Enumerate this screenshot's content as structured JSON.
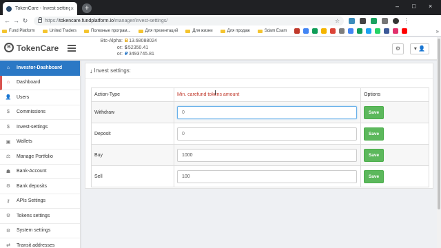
{
  "browser": {
    "tab_title": "TokenCare - Invest settings",
    "tab_close": "×",
    "new_tab": "+",
    "url_host": "tokencare.fundplatform.io",
    "url_path": "/manager/invest-settings/",
    "url_scheme": "https://",
    "window_controls": [
      "–",
      "□",
      "×"
    ],
    "bookmarks": [
      "Fund Platform",
      "United Traders",
      "Полезные програм...",
      "Для презентаций",
      "Для жизни",
      "Для продаж",
      "Sdam Exam"
    ],
    "bookmark_colors": [
      "#c0392b",
      "#4285f4",
      "#0f9d58",
      "#f4b400",
      "#db4437",
      "#7d7d7d",
      "#4285f4",
      "#0f9d58",
      "#1da1f2",
      "#25d366",
      "#3b5998",
      "#e1306c",
      "#ff0000"
    ],
    "extension_colors": [
      "#3c8dbc",
      "#444444",
      "#1aa260",
      "#777777",
      "#333333"
    ]
  },
  "header": {
    "brand": "TokenCare",
    "logo_letter": "B",
    "balances": [
      {
        "label": "Btc-Alpha:",
        "symbol": "Ƀ",
        "value": "13.68088024"
      },
      {
        "label": "or:",
        "symbol": "$",
        "value": "52350.41"
      },
      {
        "label": "or:",
        "symbol": "₽",
        "value": "3493745.81"
      }
    ],
    "settings_icon": "⚙",
    "user_icon": "▾ 👤"
  },
  "sidebar": {
    "items": [
      {
        "icon": "⌂",
        "label": "Investor-Dashboard"
      },
      {
        "icon": "⌂",
        "label": "Dashboard"
      },
      {
        "icon": "👤",
        "label": "Users"
      },
      {
        "icon": "$",
        "label": "Commissions"
      },
      {
        "icon": "$",
        "label": "Invest-settings"
      },
      {
        "icon": "▣",
        "label": "Wallets"
      },
      {
        "icon": "⚖",
        "label": "Manage Portfolio"
      },
      {
        "icon": "☗",
        "label": "Bank-Account"
      },
      {
        "icon": "⚙",
        "label": "Bank deposits"
      },
      {
        "icon": "⚷",
        "label": "APIs Settings"
      },
      {
        "icon": "⚙",
        "label": "Tokens settings"
      },
      {
        "icon": "⚙",
        "label": "System settings"
      },
      {
        "icon": "⇄",
        "label": "Transit addresses"
      }
    ]
  },
  "main": {
    "panel_title": "Invest settings:",
    "columns": [
      "Action-Type",
      "Min. carefund tokens amount",
      "Options"
    ],
    "rows": [
      {
        "action": "Withdraw",
        "value": "",
        "placeholder": "0",
        "button": "Save"
      },
      {
        "action": "Deposit",
        "value": "",
        "placeholder": "0",
        "button": "Save"
      },
      {
        "action": "Buy",
        "value": "1000",
        "placeholder": "",
        "button": "Save"
      },
      {
        "action": "Sell",
        "value": "100",
        "placeholder": "",
        "button": "Save"
      }
    ]
  }
}
